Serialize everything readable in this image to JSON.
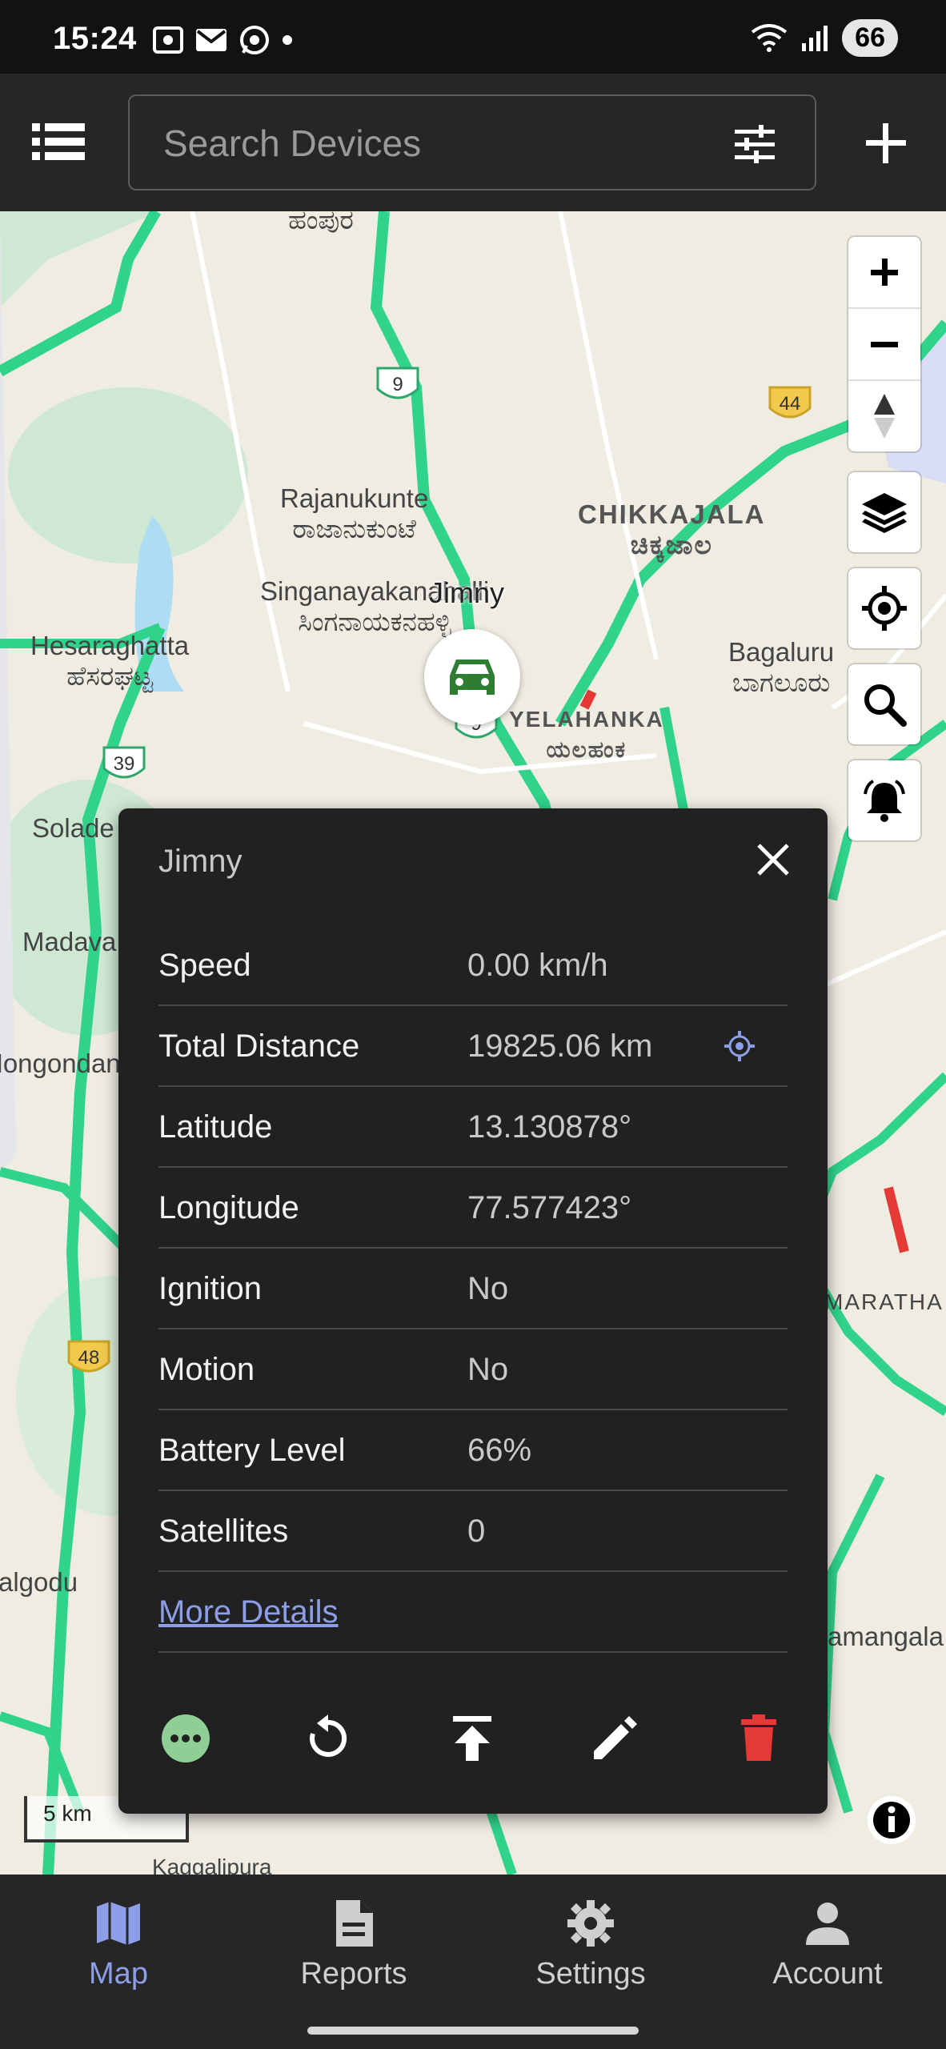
{
  "status_bar": {
    "time": "15:24",
    "battery": "66"
  },
  "search": {
    "placeholder": "Search Devices"
  },
  "map": {
    "labels": {
      "rajanukunte": "Rajanukunte",
      "rajanukunte_kn": "ರಾಜಾನುಕುಂಟೆ",
      "singanayakanahalli": "Singanayakanahalli",
      "singanayakanahalli_kn": "ಸಿಂಗನಾಯಕನಹಳ್ಳಿ",
      "hesaraghatta": "Hesaraghatta",
      "hesaraghatta_kn": "ಹೆಸರಘಟ್ಟ",
      "chikkajala": "CHIKKAJALA",
      "chikkajala_kn": "ಚಿಕ್ಕಜಾಲ",
      "bagaluru": "Bagaluru",
      "bagaluru_kn": "ಬಾಗಲೂರು",
      "yelahanka": "YELAHANKA",
      "yelahanka_kn": "ಯಲಹಂಕ",
      "solade": "Solade",
      "madava": "Madava",
      "hongondan": "Hongondan",
      "marathahalli": "MARATHA",
      "algodu": "algodu",
      "amangala": "amangala",
      "kaggalipura": "Kaggalipura",
      "top": "ಹಂಪುರ"
    },
    "highway_shields": {
      "nh9": "9",
      "nh44": "44",
      "nh39": "39",
      "nh48": "48",
      "nh9b": "9"
    },
    "marker": {
      "label": "Jimny"
    },
    "scale": "5 km"
  },
  "device_card": {
    "title": "Jimny",
    "rows": [
      {
        "key": "Speed",
        "value": "0.00 km/h"
      },
      {
        "key": "Total Distance",
        "value": "19825.06 km"
      },
      {
        "key": "Latitude",
        "value": "13.130878°"
      },
      {
        "key": "Longitude",
        "value": "77.577423°"
      },
      {
        "key": "Ignition",
        "value": "No"
      },
      {
        "key": "Motion",
        "value": "No"
      },
      {
        "key": "Battery Level",
        "value": "66%"
      },
      {
        "key": "Satellites",
        "value": "0"
      }
    ],
    "more_details": "More Details"
  },
  "bottom_nav": [
    {
      "label": "Map",
      "active": true
    },
    {
      "label": "Reports",
      "active": false
    },
    {
      "label": "Settings",
      "active": false
    },
    {
      "label": "Account",
      "active": false
    }
  ],
  "colors": {
    "accent": "#8c9ee8",
    "road": "#2fd38a",
    "delete": "#e53935",
    "more": "#8fce94"
  }
}
